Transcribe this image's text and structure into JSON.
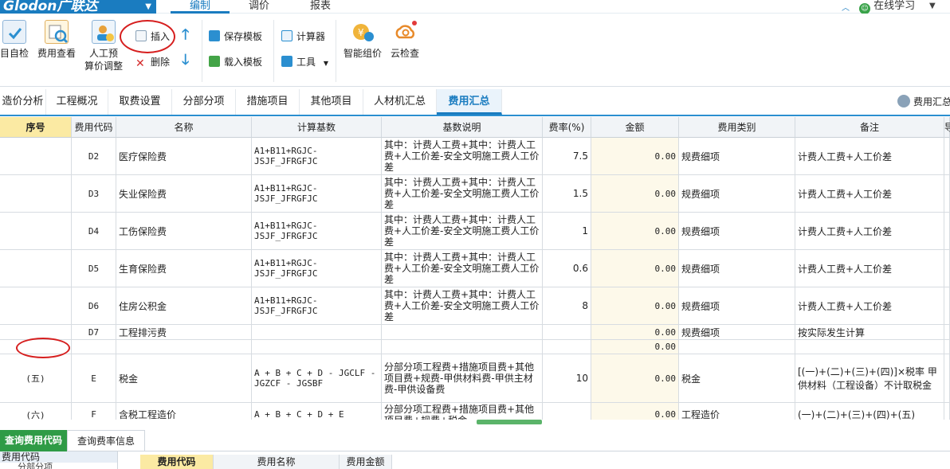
{
  "app": {
    "brand": "Glodon广联达",
    "menu_tabs": [
      "编制",
      "调价",
      "报表"
    ],
    "online_label": "在线学习"
  },
  "ribbon": {
    "self_check": "目自检",
    "fee_view": "费用查看",
    "labor_adjust_1": "人工预",
    "labor_adjust_2": "算价调整",
    "insert": "插入",
    "delete": "删除",
    "save_template": "保存模板",
    "load_template": "载入模板",
    "calculator": "计算器",
    "tools": "工具",
    "smart_price": "智能组价",
    "cloud_check": "云检查"
  },
  "nav_tabs": [
    "造价分析",
    "工程概况",
    "取费设置",
    "分部分项",
    "措施项目",
    "其他项目",
    "人材机汇总",
    "费用汇总"
  ],
  "nav_active_index": 7,
  "nav_right_label": "费用汇总",
  "table": {
    "headers": [
      "序号",
      "费用代码",
      "名称",
      "计算基数",
      "基数说明",
      "费率(%)",
      "金额",
      "费用类别",
      "备注",
      "导"
    ],
    "rows": [
      {
        "seq": "",
        "code": "D2",
        "name": "医疗保险费",
        "base": "A1+B11+RGJC-JSJF_JFRGFJC",
        "desc": "其中：计费人工费+其中：计费人工费+人工价差-安全文明施工费人工价差",
        "rate": "7.5",
        "amount": "0.00",
        "category": "规费细项",
        "note": "计费人工费+人工价差"
      },
      {
        "seq": "",
        "code": "D3",
        "name": "失业保险费",
        "base": "A1+B11+RGJC-JSJF_JFRGFJC",
        "desc": "其中：计费人工费+其中：计费人工费+人工价差-安全文明施工费人工价差",
        "rate": "1.5",
        "amount": "0.00",
        "category": "规费细项",
        "note": "计费人工费+人工价差"
      },
      {
        "seq": "",
        "code": "D4",
        "name": "工伤保险费",
        "base": "A1+B11+RGJC-JSJF_JFRGFJC",
        "desc": "其中：计费人工费+其中：计费人工费+人工价差-安全文明施工费人工价差",
        "rate": "1",
        "amount": "0.00",
        "category": "规费细项",
        "note": "计费人工费+人工价差"
      },
      {
        "seq": "",
        "code": "D5",
        "name": "生育保险费",
        "base": "A1+B11+RGJC-JSJF_JFRGFJC",
        "desc": "其中：计费人工费+其中：计费人工费+人工价差-安全文明施工费人工价差",
        "rate": "0.6",
        "amount": "0.00",
        "category": "规费细项",
        "note": "计费人工费+人工价差"
      },
      {
        "seq": "",
        "code": "D6",
        "name": "住房公积金",
        "base": "A1+B11+RGJC-JSJF_JFRGFJC",
        "desc": "其中：计费人工费+其中：计费人工费+人工价差-安全文明施工费人工价差",
        "rate": "8",
        "amount": "0.00",
        "category": "规费细项",
        "note": "计费人工费+人工价差"
      },
      {
        "seq": "",
        "code": "D7",
        "name": "工程排污费",
        "base": "",
        "desc": "",
        "rate": "",
        "amount": "0.00",
        "category": "规费细项",
        "note": "按实际发生计算"
      },
      {
        "seq": "",
        "code": "",
        "name": "",
        "base": "",
        "desc": "",
        "rate": "",
        "amount": "0.00",
        "category": "",
        "note": ""
      },
      {
        "seq": "(五)",
        "code": "E",
        "name": "税金",
        "base": "A + B + C + D - JGCLF - JGZCF - JGSBF",
        "desc": "分部分项工程费+措施项目费+其他项目费+规费-甲供材料费-甲供主材费-甲供设备费",
        "rate": "10",
        "amount": "0.00",
        "category": "税金",
        "note": "[(一)+(二)+(三)+(四)]×税率 甲供材料（工程设备）不计取税金"
      },
      {
        "seq": "(六)",
        "code": "F",
        "name": "含税工程造价",
        "base": "A + B + C + D + E",
        "desc": "分部分项工程费+措施项目费+其他项目费+规费+税金",
        "rate": "",
        "amount": "0.00",
        "category": "工程造价",
        "note": "(一)+(二)+(三)+(四)+(五)"
      }
    ]
  },
  "bottom": {
    "tabs": [
      "查询费用代码",
      "查询费率信息"
    ],
    "tree_root": "费用代码",
    "tree_child": "分部分项",
    "headers": [
      "费用代码",
      "费用名称",
      "费用金额"
    ]
  },
  "colors": {
    "brand_blue": "#1a7cc0",
    "active_green": "#2f9b46",
    "highlight_yellow": "#fbeaa3",
    "annotation_red": "#d61e1e"
  }
}
